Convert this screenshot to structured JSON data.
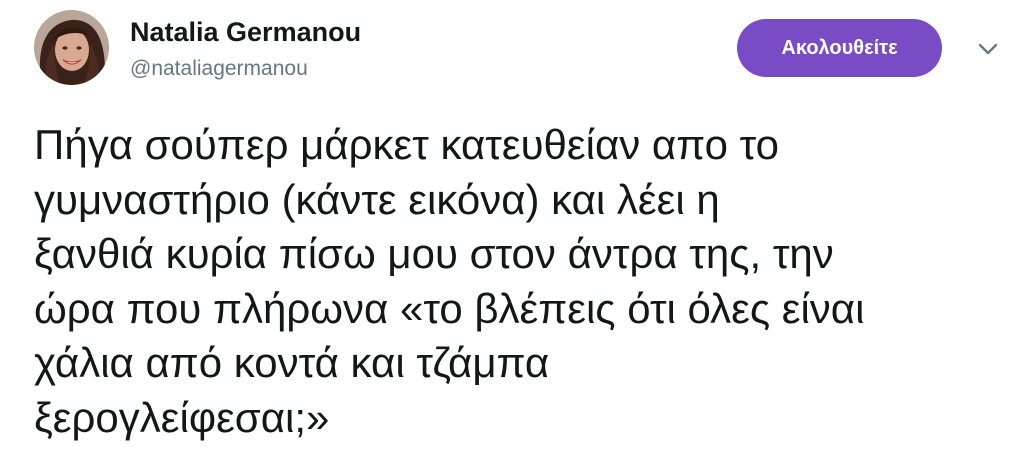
{
  "tweet": {
    "author": {
      "name": "Natalia Germanou",
      "handle": "@nataliagermanou",
      "avatar_icon": "profile-photo"
    },
    "follow_button": {
      "label": "Ακολουθείτε",
      "color": "#794bc4"
    },
    "menu_icon": "chevron-down-icon",
    "text_lines": [
      "Πήγα σούπερ μάρκετ κατευθείαν απο το",
      "γυμναστήριο (κάντε εικόνα) και λέει η",
      "ξανθιά κυρία πίσω μου στον άντρα της, την",
      "ώρα που πλήρωνα «το βλέπεις ότι όλες είναι",
      "χάλια από κοντά και τζάμπα",
      "ξερογλείφεσαι;»"
    ]
  }
}
